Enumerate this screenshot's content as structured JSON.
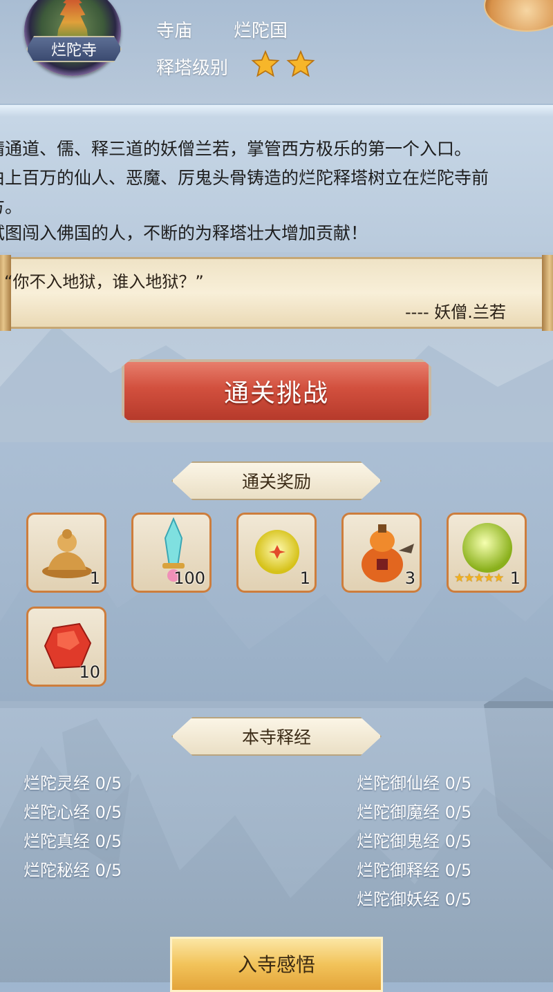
{
  "header": {
    "temple_name": "烂陀寺",
    "type_label": "寺庙",
    "kingdom": "烂陀国",
    "tower_level_label": "释塔级别",
    "tower_stars": 2
  },
  "description": {
    "lines": [
      "精通道、儒、释三道的妖僧兰若，掌管西方极乐的第一个入口。",
      "由上百万的仙人、恶魔、厉鬼头骨铸造的烂陀释塔树立在烂陀寺前",
      "方。",
      "试图闯入佛国的人，不断的为释塔壮大增加贡献！"
    ]
  },
  "quote": {
    "text": "“你不入地狱，谁入地狱？”",
    "attribution": "---- 妖僧.兰若"
  },
  "challenge_button": "通关挑战",
  "rewards": {
    "title": "通关奖励",
    "items": [
      {
        "icon": "buddha-statue-icon",
        "count": "1"
      },
      {
        "icon": "jade-sword-icon",
        "count": "100"
      },
      {
        "icon": "golden-orb-icon",
        "count": "1"
      },
      {
        "icon": "gourd-icon",
        "count": "3"
      },
      {
        "icon": "green-pearl-icon",
        "count": "1",
        "stars": 5
      },
      {
        "icon": "red-gem-icon",
        "count": "10"
      }
    ]
  },
  "scriptures": {
    "title": "本寺释经",
    "left": [
      "烂陀灵经 0/5",
      "烂陀心经 0/5",
      "烂陀真经 0/5",
      "烂陀秘经 0/5"
    ],
    "right": [
      "烂陀御仙经 0/5",
      "烂陀御魔经 0/5",
      "烂陀御鬼经 0/5",
      "烂陀御释经 0/5",
      "烂陀御妖经 0/5"
    ]
  },
  "enter_button": "入寺感悟",
  "colors": {
    "challenge_red": "#d2503e",
    "slot_border": "#cd7d3c",
    "enter_gold": "#f2c35a"
  }
}
